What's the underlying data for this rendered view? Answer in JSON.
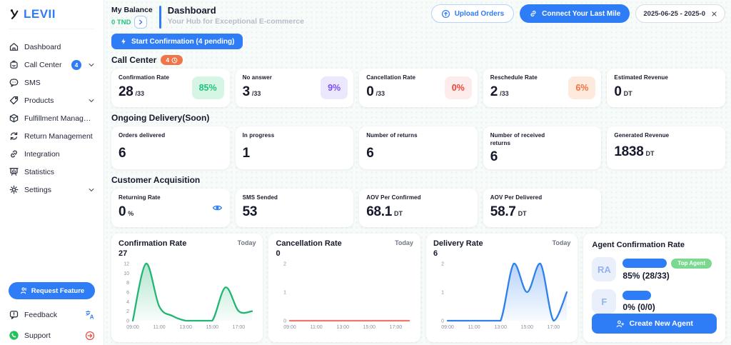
{
  "colors": {
    "primary": "#2e7cf6",
    "green": "#22b573",
    "red": "#f2756c",
    "blue": "#2f80ed",
    "orange": "#f0764a"
  },
  "app": {
    "logo_text": "LEVII"
  },
  "sidebar": {
    "items": [
      {
        "label": "Dashboard"
      },
      {
        "label": "Call Center",
        "badge": "4"
      },
      {
        "label": "SMS"
      },
      {
        "label": "Products"
      },
      {
        "label": "Fulfillment Management"
      },
      {
        "label": "Return Management"
      },
      {
        "label": "Integration"
      },
      {
        "label": "Statistics"
      },
      {
        "label": "Settings"
      }
    ],
    "request_feature": "Request Feature",
    "feedback": "Feedback",
    "support": "Support"
  },
  "header": {
    "balance_label": "My Balance",
    "balance_value": "0 TND",
    "title": "Dashboard",
    "subtitle": "Your Hub for Exceptional E-commerce",
    "upload_button": "Upload Orders",
    "connect_button": "Connect Your Last Mile",
    "date_range": "2025-06-25 - 2025-0"
  },
  "actions": {
    "start_confirmation": "Start Confirmation (4 pending)"
  },
  "sections": {
    "call_center": {
      "title": "Call Center",
      "badge": "4",
      "cards": [
        {
          "label": "Confirmation Rate",
          "value": "28",
          "unit": "/33",
          "badge": "85%"
        },
        {
          "label": "No answer",
          "value": "3",
          "unit": "/33",
          "badge": "9%"
        },
        {
          "label": "Cancellation Rate",
          "value": "0",
          "unit": "/33",
          "badge": "0%"
        },
        {
          "label": "Reschedule Rate",
          "value": "2",
          "unit": "/33",
          "badge": "6%"
        },
        {
          "label": "Estimated Revenue",
          "value": "0",
          "unit": "DT"
        }
      ]
    },
    "ongoing_delivery": {
      "title": "Ongoing Delivery(Soon)",
      "cards": [
        {
          "label": "Orders delivered",
          "value": "6"
        },
        {
          "label": "In progress",
          "value": "1"
        },
        {
          "label": "Number of returns",
          "value": "6"
        },
        {
          "label": "Number of received returns",
          "value": "6"
        },
        {
          "label": "Generated Revenue",
          "value": "1838",
          "unit": "DT"
        }
      ]
    },
    "customer_acquisition": {
      "title": "Customer Acquisition",
      "cards": [
        {
          "label": "Returning Rate",
          "value": "0",
          "unit": "%"
        },
        {
          "label": "SMS Sended",
          "value": "53"
        },
        {
          "label": "AOV Per Confirmed",
          "value": "68.1",
          "unit": "DT"
        },
        {
          "label": "AOV Per Delivered",
          "value": "58.7",
          "unit": "DT"
        }
      ]
    }
  },
  "chart_data": [
    {
      "type": "area",
      "title": "Confirmation Rate",
      "total": "27",
      "period": "Today",
      "color": "#22b573",
      "x": [
        9,
        10,
        11,
        12,
        13,
        14,
        15,
        16,
        17,
        18
      ],
      "values": [
        0,
        12,
        3,
        1,
        0,
        0,
        0,
        7,
        2,
        2
      ],
      "ylim": [
        0,
        12
      ],
      "yticks": [
        0,
        2,
        4,
        6,
        8,
        10,
        12
      ],
      "xtick_values": [
        9,
        11,
        13,
        15,
        17
      ],
      "xticks": [
        "09:00",
        "11:00",
        "13:00",
        "15:00",
        "17:00"
      ],
      "xlabel": "",
      "ylabel": "",
      "grid": false,
      "legend": false
    },
    {
      "type": "area",
      "title": "Cancellation Rate",
      "total": "0",
      "period": "Today",
      "color": "#f2756c",
      "x": [
        9,
        10,
        11,
        12,
        13,
        14,
        15,
        16,
        17,
        18
      ],
      "values": [
        0,
        0,
        0,
        0,
        0,
        0,
        0,
        0,
        0,
        0
      ],
      "ylim": [
        0,
        2
      ],
      "yticks": [
        0,
        1,
        2
      ],
      "xtick_values": [
        9,
        11,
        13,
        15,
        17
      ],
      "xticks": [
        "09:00",
        "11:00",
        "13:00",
        "15:00",
        "17:00"
      ],
      "xlabel": "",
      "ylabel": "",
      "grid": false,
      "legend": false
    },
    {
      "type": "area",
      "title": "Delivery Rate",
      "total": "6",
      "period": "Today",
      "color": "#2f80ed",
      "x": [
        9,
        10,
        11,
        12,
        13,
        14,
        15,
        16,
        17,
        18
      ],
      "values": [
        0,
        0,
        0,
        0,
        0,
        2,
        1,
        2,
        0,
        1
      ],
      "ylim": [
        0,
        2
      ],
      "yticks": [
        0,
        1,
        2
      ],
      "xtick_values": [
        9,
        11,
        13,
        15,
        17
      ],
      "xticks": [
        "09:00",
        "11:00",
        "13:00",
        "15:00",
        "17:00"
      ],
      "xlabel": "",
      "ylabel": "",
      "grid": false,
      "legend": false
    }
  ],
  "agent_panel": {
    "title": "Agent Confirmation Rate",
    "rows": [
      {
        "initials": "RA",
        "stat": "85% (28/33)",
        "badge": "Top Agent",
        "bar_style": "width:62px"
      },
      {
        "initials": "F",
        "stat": "0% (0/0)",
        "bar_style": "width:40px"
      }
    ],
    "create_button": "Create New Agent"
  }
}
